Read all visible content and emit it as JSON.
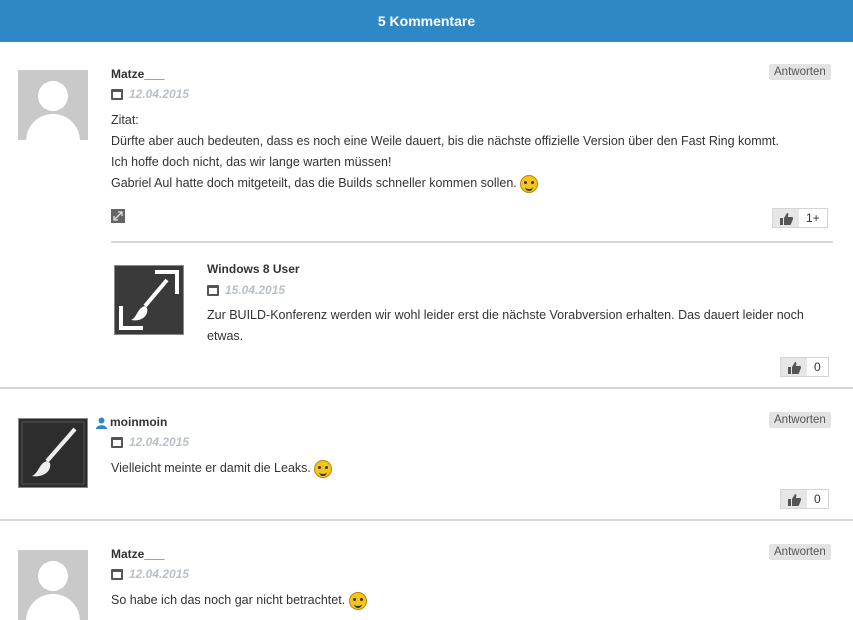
{
  "header": {
    "title": "5 Kommentare"
  },
  "reply_label": "Antworten",
  "comments": [
    {
      "author": "Matze___",
      "date": "12.04.2015",
      "lines": [
        "Zitat:",
        "Dürfte aber auch bedeuten, dass es noch eine Weile dauert, bis die nächste offizielle Version über den Fast Ring kommt.",
        "Ich hoffe doch nicht, das wir lange warten müssen!",
        "Gabriel Aul hatte doch mitgeteilt, das die Builds schneller kommen sollen."
      ],
      "votes": "1+",
      "avatar": "default-user-avatar"
    },
    {
      "author": "Windows 8 User",
      "date": "15.04.2015",
      "lines": [
        "Zur BUILD-Konferenz werden wir wohl leider erst die nächste Vorabversion erhalten. Das dauert leider noch",
        "etwas."
      ],
      "votes": "0",
      "avatar": "brush-logo-avatar"
    },
    {
      "author": "moinmoin",
      "date": "12.04.2015",
      "lines": [
        "Vielleicht meinte er damit die Leaks."
      ],
      "votes": "0",
      "avatar": "brush-logo-avatar"
    },
    {
      "author": "Matze___",
      "date": "12.04.2015",
      "lines": [
        "So habe ich das noch gar nicht betrachtet."
      ],
      "avatar": "default-user-avatar"
    }
  ],
  "colors": {
    "header_bg": "#2f88c6",
    "date": "#b9c0c8",
    "divider": "#d7d7d7"
  }
}
